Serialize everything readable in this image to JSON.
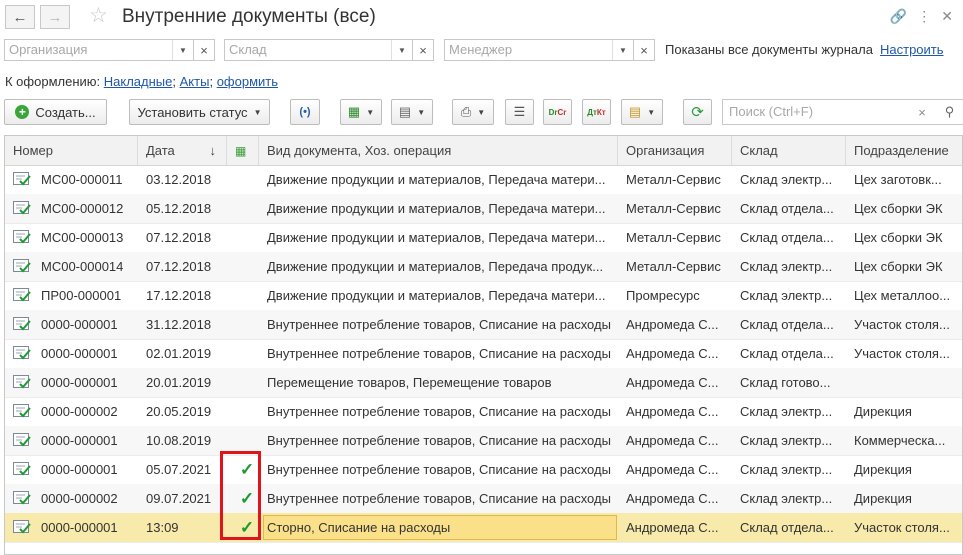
{
  "window": {
    "title": "Внутренние документы (все)"
  },
  "filters": {
    "organization_placeholder": "Организация",
    "warehouse_placeholder": "Склад",
    "manager_placeholder": "Менеджер",
    "status_text": "Показаны все документы журнала",
    "configure_link": "Настроить"
  },
  "todo": {
    "label": "К оформлению:",
    "links": [
      "Накладные",
      "Акты",
      "оформить"
    ]
  },
  "toolbar": {
    "create_label": "Создать...",
    "set_status_label": "Установить статус",
    "search_placeholder": "Поиск (Ctrl+F)"
  },
  "table": {
    "columns": [
      "Номер",
      "Дата",
      "",
      "Вид документа, Хоз. операция",
      "Организация",
      "Склад",
      "Подразделение"
    ],
    "rows": [
      {
        "number": "МС00-000011",
        "date": "03.12.2018",
        "check": "",
        "type": "Движение продукции и материалов, Передача матери...",
        "org": "Металл-Сервис",
        "wh": "Склад электр...",
        "dept": "Цех заготовк..."
      },
      {
        "number": "МС00-000012",
        "date": "05.12.2018",
        "check": "",
        "type": "Движение продукции и материалов, Передача матери...",
        "org": "Металл-Сервис",
        "wh": "Склад отдела...",
        "dept": "Цех сборки ЭК"
      },
      {
        "number": "МС00-000013",
        "date": "07.12.2018",
        "check": "",
        "type": "Движение продукции и материалов, Передача матери...",
        "org": "Металл-Сервис",
        "wh": "Склад отдела...",
        "dept": "Цех сборки ЭК"
      },
      {
        "number": "МС00-000014",
        "date": "07.12.2018",
        "check": "",
        "type": "Движение продукции и материалов, Передача продук...",
        "org": "Металл-Сервис",
        "wh": "Склад электр...",
        "dept": "Цех сборки ЭК"
      },
      {
        "number": "ПР00-000001",
        "date": "17.12.2018",
        "check": "",
        "type": "Движение продукции и материалов, Передача матери...",
        "org": "Промресурс",
        "wh": "Склад электр...",
        "dept": "Цех металлоо..."
      },
      {
        "number": "0000-000001",
        "date": "31.12.2018",
        "check": "",
        "type": "Внутреннее потребление товаров, Списание на расходы",
        "org": "Андромеда С...",
        "wh": "Склад отдела...",
        "dept": "Участок столя..."
      },
      {
        "number": "0000-000001",
        "date": "02.01.2019",
        "check": "",
        "type": "Внутреннее потребление товаров, Списание на расходы",
        "org": "Андромеда С...",
        "wh": "Склад отдела...",
        "dept": "Участок столя..."
      },
      {
        "number": "0000-000001",
        "date": "20.01.2019",
        "check": "",
        "type": "Перемещение товаров, Перемещение товаров",
        "org": "Андромеда С...",
        "wh": "Склад готово...",
        "dept": ""
      },
      {
        "number": "0000-000002",
        "date": "20.05.2019",
        "check": "",
        "type": "Внутреннее потребление товаров, Списание на расходы",
        "org": "Андромеда С...",
        "wh": "Склад электр...",
        "dept": "Дирекция"
      },
      {
        "number": "0000-000001",
        "date": "10.08.2019",
        "check": "",
        "type": "Внутреннее потребление товаров, Списание на расходы",
        "org": "Андромеда С...",
        "wh": "Склад электр...",
        "dept": "Коммерческа..."
      },
      {
        "number": "0000-000001",
        "date": "05.07.2021",
        "check": "✓",
        "type": "Внутреннее потребление товаров, Списание на расходы",
        "org": "Андромеда С...",
        "wh": "Склад электр...",
        "dept": "Дирекция"
      },
      {
        "number": "0000-000002",
        "date": "09.07.2021",
        "check": "✓",
        "type": "Внутреннее потребление товаров, Списание на расходы",
        "org": "Андромеда С...",
        "wh": "Склад электр...",
        "dept": "Дирекция"
      },
      {
        "number": "0000-000001",
        "date": "13:09",
        "check": "✓",
        "type": "Сторно, Списание на расходы",
        "org": "Андромеда С...",
        "wh": "Склад отдела...",
        "dept": "Участок столя..."
      }
    ]
  },
  "colors": {
    "accent_link": "#1f57a8",
    "selected_row": "#f8eaaa",
    "check": "#1a9a2e",
    "highlight_box": "#e0141a"
  }
}
